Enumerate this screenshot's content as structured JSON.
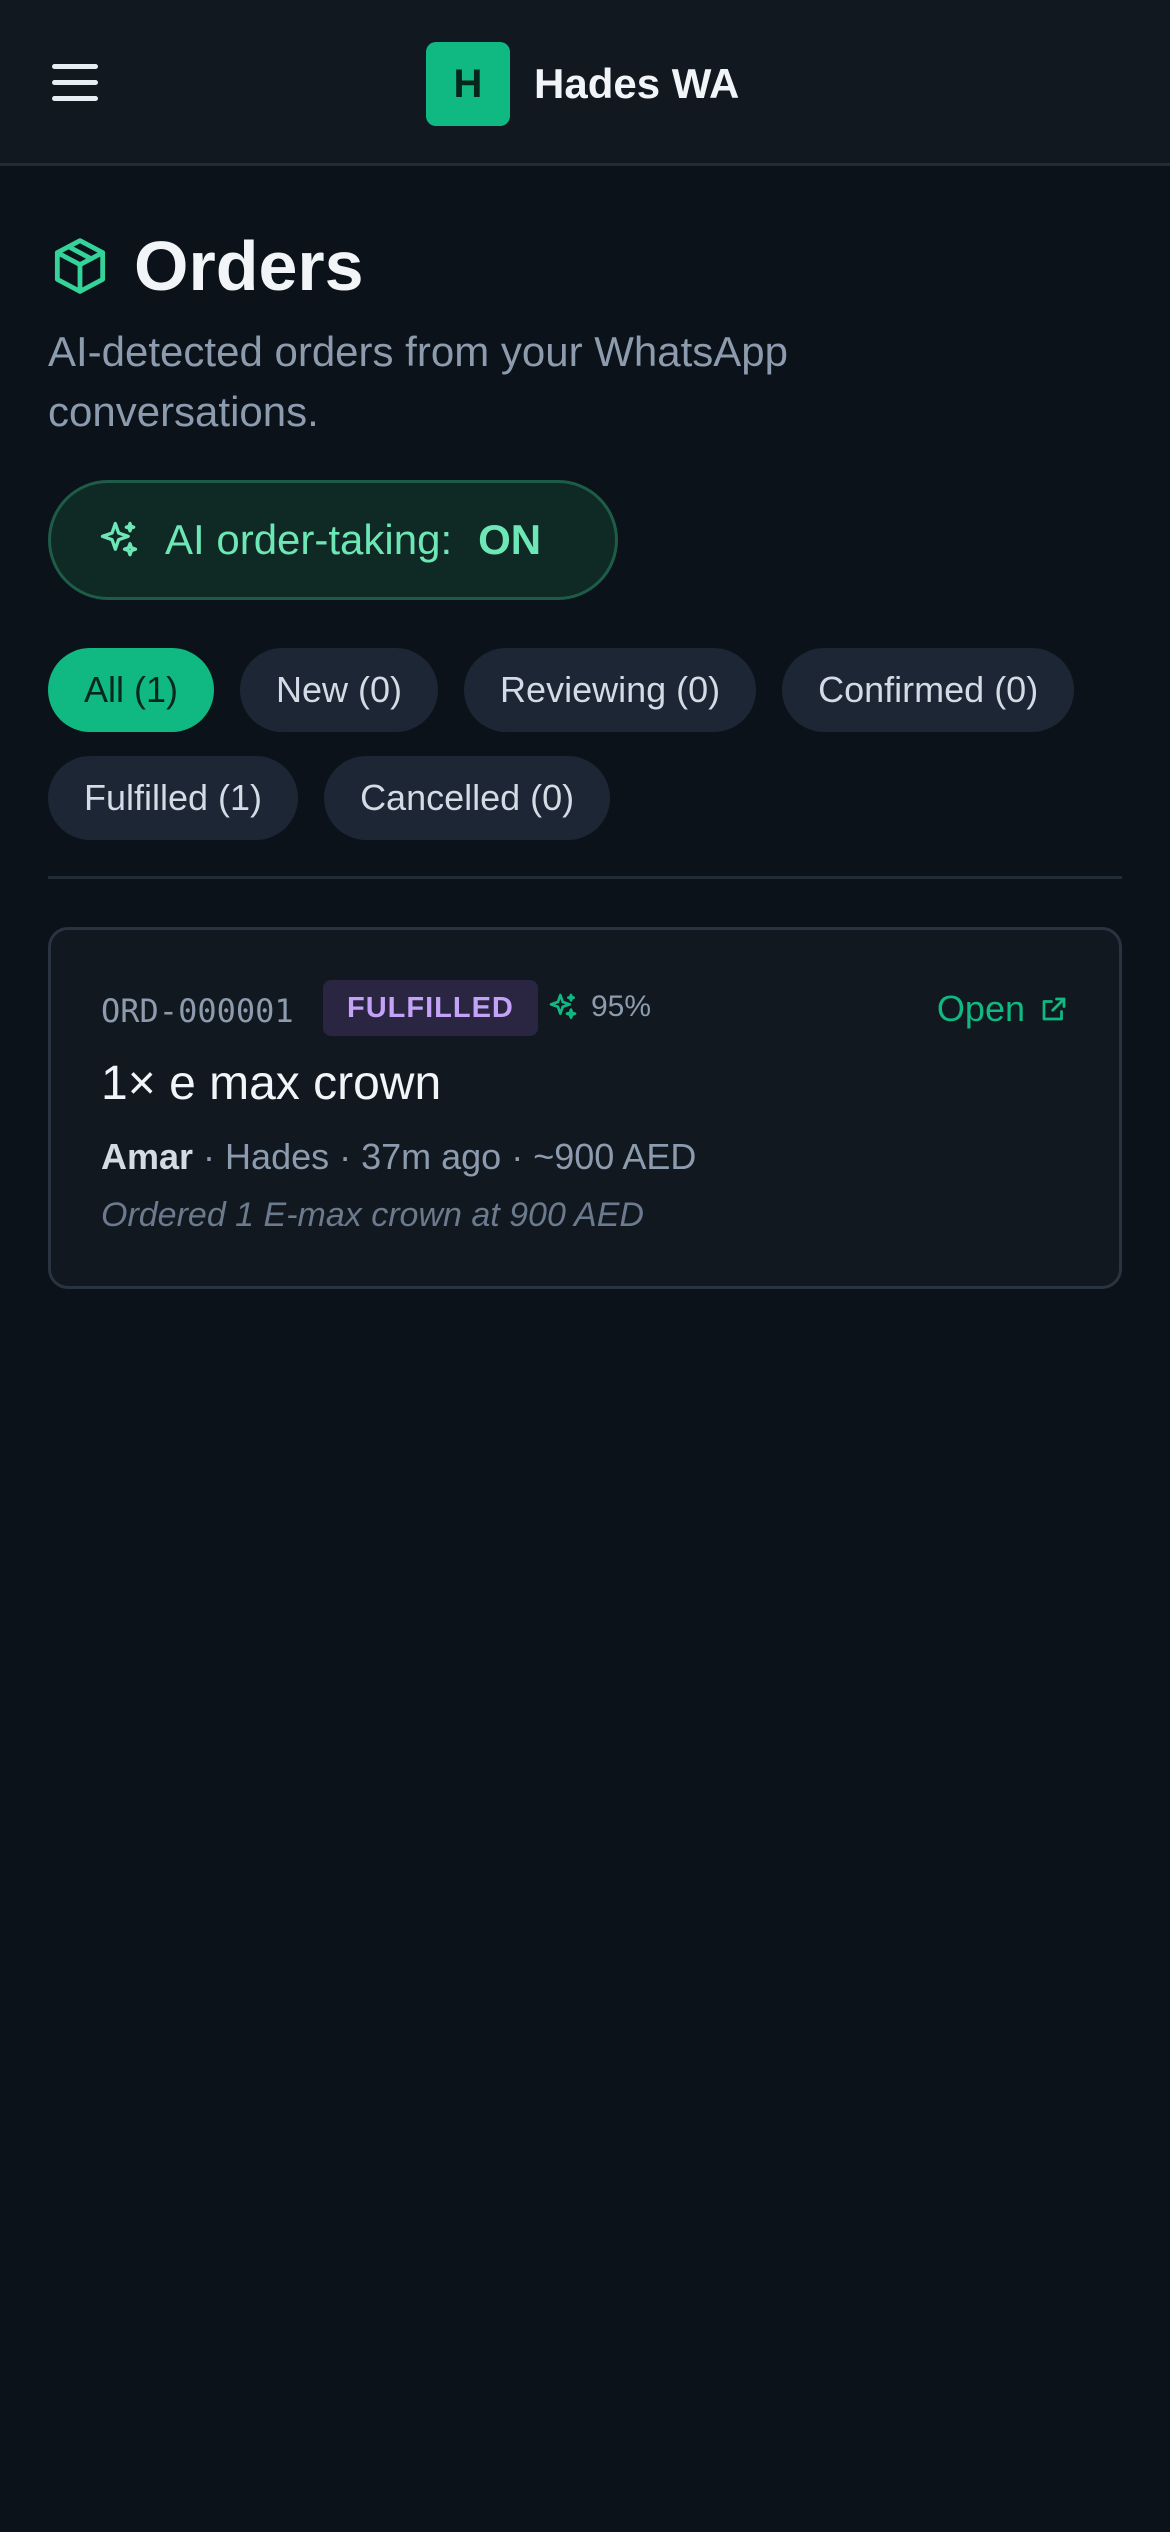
{
  "header": {
    "menu_icon": "hamburger-menu-icon",
    "logo_letter": "H",
    "app_name": "Hades WA",
    "brand_color": "#10b981"
  },
  "page": {
    "title_icon": "package-box-icon",
    "title": "Orders",
    "subtitle": "AI-detected orders from your WhatsApp conversations."
  },
  "ai_toggle": {
    "icon": "sparkles-icon",
    "label": "AI order-taking:",
    "state": "ON"
  },
  "filters": [
    {
      "label": "All (1)",
      "active": true
    },
    {
      "label": "New (0)",
      "active": false
    },
    {
      "label": "Reviewing (0)",
      "active": false
    },
    {
      "label": "Confirmed (0)",
      "active": false
    },
    {
      "label": "Fulfilled (1)",
      "active": false
    },
    {
      "label": "Cancelled (0)",
      "active": false
    }
  ],
  "orders": [
    {
      "id": "ORD-000001",
      "status": "FULFILLED",
      "status_color": "#c4a2f7",
      "confidence": "95%",
      "open_label": "Open",
      "title": "1× e max crown",
      "customer": "Amar",
      "meta_sep": " · ",
      "agent": "Hades",
      "time": "37m ago",
      "amount": "~900 AED",
      "note": "Ordered 1 E-max crown at 900 AED"
    }
  ]
}
